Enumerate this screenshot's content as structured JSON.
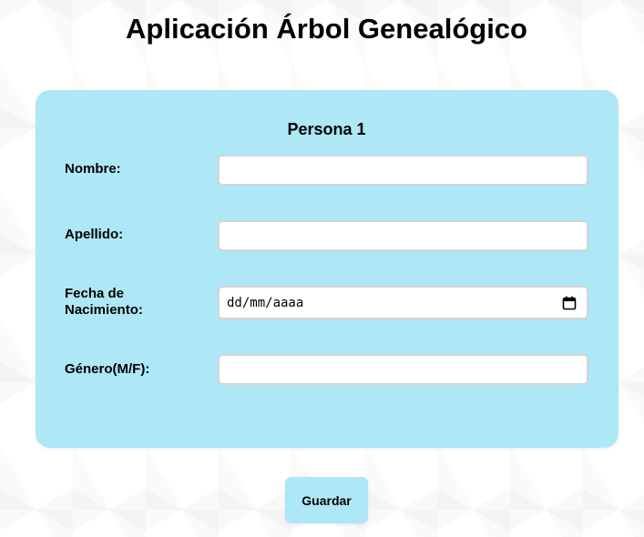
{
  "app": {
    "title": "Aplicación Árbol Genealógico"
  },
  "form": {
    "title": "Persona 1",
    "fields": [
      {
        "label": "Nombre:",
        "value": "",
        "placeholder": ""
      },
      {
        "label": "Apellido:",
        "value": "",
        "placeholder": ""
      },
      {
        "label": "Fecha de Nacimiento:",
        "value": "",
        "placeholder": "dd/mm/aaaa",
        "icon": "calendar-icon"
      },
      {
        "label": "Género(M/F):",
        "value": "",
        "placeholder": ""
      }
    ]
  },
  "actions": {
    "save_label": "Guardar"
  },
  "colors": {
    "card_background": "#aee7f5",
    "button_background": "#aee7f5"
  }
}
